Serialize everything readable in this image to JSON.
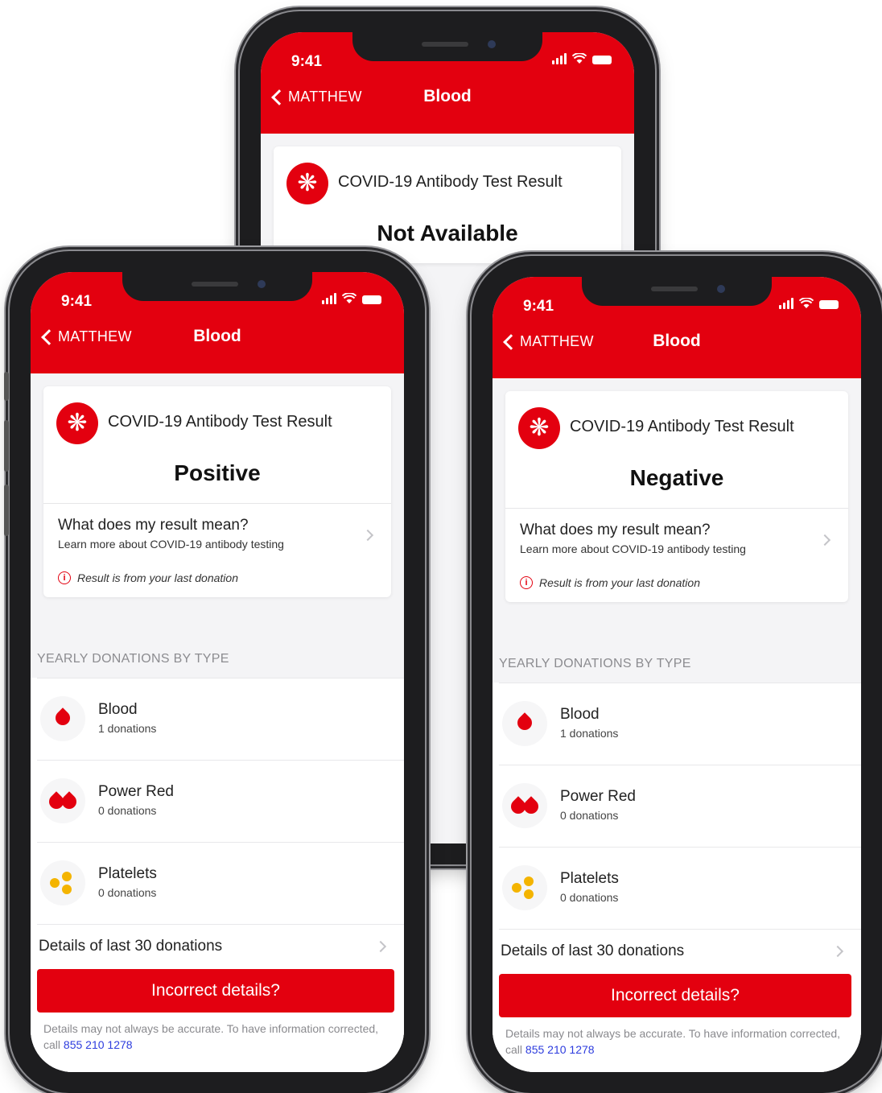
{
  "theme": {
    "brand_red": "#e3000f",
    "link_blue": "#2d3cde"
  },
  "screens": {
    "back": {
      "status_time": "9:41",
      "nav_back_label": "MATTHEW",
      "nav_title": "Blood",
      "card_title": "COVID-19 Antibody Test Result",
      "result": "Not Available"
    },
    "left": {
      "status_time": "9:41",
      "nav_back_label": "MATTHEW",
      "nav_title": "Blood",
      "card_title": "COVID-19 Antibody Test Result",
      "result": "Positive",
      "meaning_title": "What does my result mean?",
      "meaning_subtitle": "Learn more about COVID-19 antibody testing",
      "info_note": "Result is from your last donation",
      "section_title": "YEARLY DONATIONS BY TYPE",
      "donations": [
        {
          "name": "Blood",
          "count": "1 donations",
          "icon": "blood-drop-icon"
        },
        {
          "name": "Power Red",
          "count": "0 donations",
          "icon": "double-drop-icon"
        },
        {
          "name": "Platelets",
          "count": "0 donations",
          "icon": "platelets-icon"
        }
      ],
      "details_label": "Details of last 30 donations",
      "incorrect_button": "Incorrect details?",
      "disclaimer_text": "Details may not always be accurate. To have information corrected, call ",
      "phone_number": "855 210 1278"
    },
    "right": {
      "status_time": "9:41",
      "nav_back_label": "MATTHEW",
      "nav_title": "Blood",
      "card_title": "COVID-19 Antibody Test Result",
      "result": "Negative",
      "meaning_title": "What does my result mean?",
      "meaning_subtitle": "Learn more about COVID-19 antibody testing",
      "info_note": "Result is from your last donation",
      "section_title": "YEARLY DONATIONS BY TYPE",
      "donations": [
        {
          "name": "Blood",
          "count": "1 donations",
          "icon": "blood-drop-icon"
        },
        {
          "name": "Power Red",
          "count": "0 donations",
          "icon": "double-drop-icon"
        },
        {
          "name": "Platelets",
          "count": "0 donations",
          "icon": "platelets-icon"
        }
      ],
      "details_label": "Details of last 30 donations",
      "incorrect_button": "Incorrect details?",
      "disclaimer_text": "Details may not always be accurate. To have information corrected, call ",
      "phone_number": "855 210 1278"
    }
  }
}
